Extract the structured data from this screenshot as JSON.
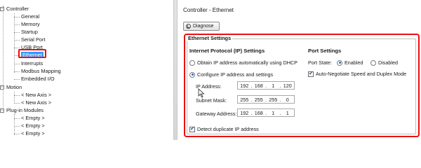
{
  "tree": {
    "controller": "Controller",
    "controller_children": [
      "General",
      "Memory",
      "Startup",
      "Serial Port",
      "USB Port",
      "Ethernet",
      "Interrupts",
      "Modbus Mapping",
      "Embedded I/O"
    ],
    "motion": "Motion",
    "motion_children": [
      "< New Axis >",
      "< New Axis >"
    ],
    "plugin": "Plug-in Modules",
    "plugin_children": [
      "< Empty >",
      "< Empty >",
      "< Empty >"
    ],
    "expand_glyph": "−"
  },
  "panel": {
    "title": "Controller - Ethernet",
    "diagnose_label": "Diagnose",
    "group_title": "Ethernet Settings",
    "ip_section": "Internet Protocol (IP) Settings",
    "dhcp_label": "Obtain IP address automatically using DHCP",
    "manual_label": "Configure IP address and settings",
    "ip_label": "IP Address:",
    "mask_label": "Subnet Mask:",
    "gateway_label": "Gateway Address:",
    "ip": [
      "192",
      "168",
      "1",
      "120"
    ],
    "mask": [
      "255",
      "255",
      "255",
      "0"
    ],
    "gateway": [
      "192",
      "168",
      "1",
      "1"
    ],
    "dot": ".",
    "detect_label": "Detect duplicate IP address",
    "port_section": "Port Settings",
    "port_state_label": "Port State:",
    "enabled_label": "Enabled",
    "disabled_label": "Disabled",
    "autoneg_label": "Auto-Negotiate Speed and Duplex Mode",
    "check_mark": "✔"
  },
  "colors": {
    "highlight_box": "#e81010",
    "selection": "#3399ff"
  }
}
